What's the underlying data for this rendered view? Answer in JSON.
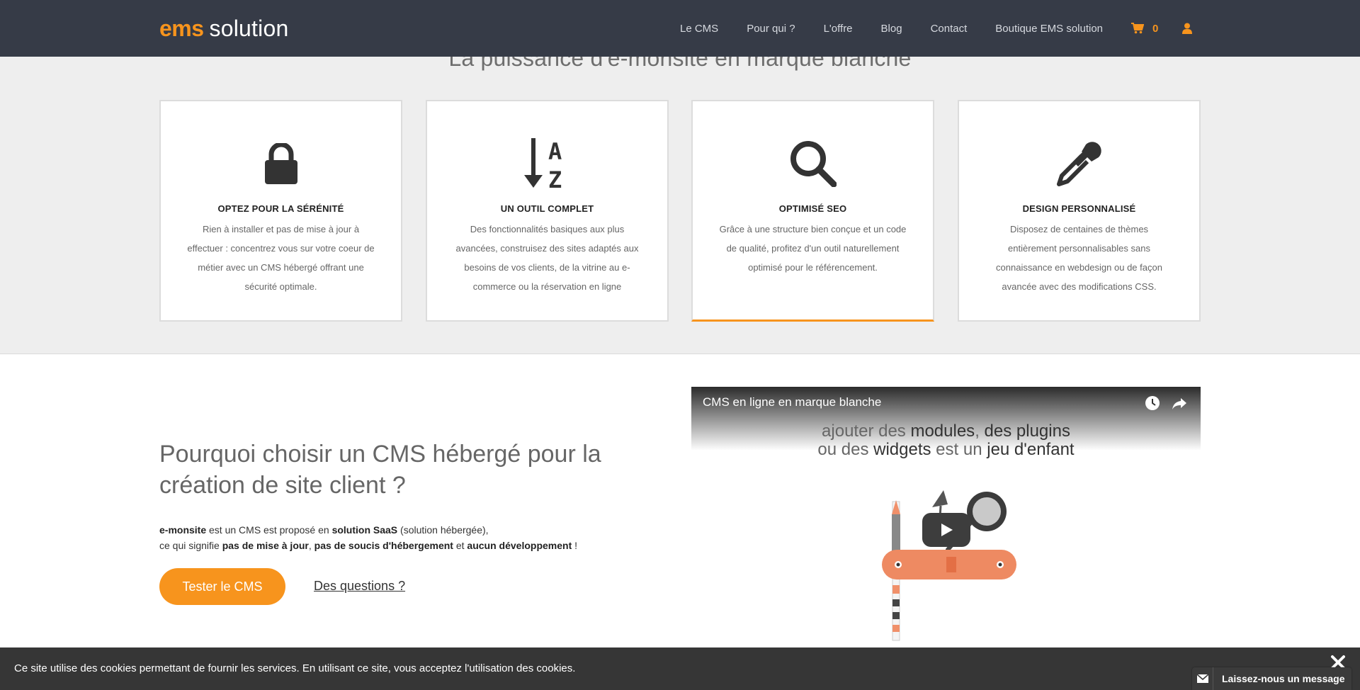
{
  "header": {
    "logo_brand": "ems",
    "logo_suffix": "solution",
    "nav": [
      "Le CMS",
      "Pour qui ?",
      "L'offre",
      "Blog",
      "Contact",
      "Boutique EMS solution"
    ],
    "cart_count": "0"
  },
  "features": {
    "title": "La puissance d'e-monsite en marque blanche",
    "cards": [
      {
        "icon": "lock-icon",
        "title": "OPTEZ POUR LA SÉRÉNITÉ",
        "text": "Rien à installer et pas de mise à jour à effectuer : concentrez vous sur votre coeur de métier avec un CMS hébergé offrant une sécurité optimale."
      },
      {
        "icon": "sort-alpha-icon",
        "title": "UN OUTIL COMPLET",
        "text": "Des fonctionnalités basiques aux plus avancées, construisez des sites adaptés aux besoins de vos clients, de la vitrine au e-commerce ou la réservation en ligne"
      },
      {
        "icon": "search-icon",
        "title": "OPTIMISÉ SEO",
        "text": "Grâce à une structure bien conçue et un code de qualité, profitez d'un outil naturellement optimisé pour le référencement."
      },
      {
        "icon": "eyedropper-icon",
        "title": "DESIGN PERSONNALISÉ",
        "text": "Disposez de centaines de thèmes entièrement personnalisables sans connaissance en webdesign ou de façon avancée avec des modifications CSS."
      }
    ],
    "accent_color": "#f7941d"
  },
  "why": {
    "title": "Pourquoi choisir un CMS hébergé pour la création de site client ?",
    "p1_a": "e-monsite",
    "p1_b": " est un CMS est proposé en ",
    "p1_c": "solution SaaS",
    "p1_d": " (solution hébergée),",
    "p2_a": "ce qui signifie ",
    "p2_b": "pas de mise à jour",
    "p2_c": ", ",
    "p2_d": "pas de soucis d'hébergement",
    "p2_e": " et ",
    "p2_f": "aucun développement",
    "p2_g": " !",
    "cta_label": "Tester le CMS",
    "questions_label": "Des questions ?"
  },
  "video": {
    "title": "CMS en ligne en marque blanche",
    "caption_l1_a": "ajouter des ",
    "caption_l1_b": "modules",
    "caption_l1_c": ", ",
    "caption_l1_d": "des plugins",
    "caption_l2_a": "ou des ",
    "caption_l2_b": "widgets",
    "caption_l2_c": " est un ",
    "caption_l2_d": "jeu d'enfant"
  },
  "cookie": {
    "text": "Ce site utilise des cookies permettant de fournir les services. En utilisant ce site, vous acceptez l'utilisation des cookies.",
    "message_label": "Laissez-nous un message"
  },
  "colors": {
    "header_bg": "#363b47",
    "accent": "#f7941d",
    "section_bg": "#eeeeee",
    "cookie_bg": "#363636"
  }
}
